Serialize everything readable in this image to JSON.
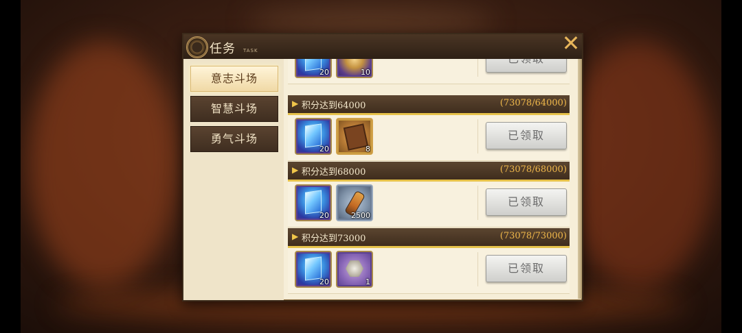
{
  "panel": {
    "title": "任务",
    "title_sub": "TASK",
    "close_symbol": "✕"
  },
  "sidebar": {
    "tabs": [
      {
        "label": "意志斗场",
        "active": true
      },
      {
        "label": "智慧斗场",
        "active": false
      },
      {
        "label": "勇气斗场",
        "active": false
      }
    ]
  },
  "tasks": [
    {
      "title": "",
      "progress": "",
      "rewards": [
        {
          "icon": "crystal-icon",
          "qty": "20"
        },
        {
          "icon": "compass-icon",
          "qty": "10"
        }
      ],
      "button": "已领取"
    },
    {
      "title": "积分达到64000",
      "progress": "(73078/64000)",
      "rewards": [
        {
          "icon": "crystal-icon",
          "qty": "20"
        },
        {
          "icon": "book-icon",
          "qty": "8"
        }
      ],
      "button": "已领取"
    },
    {
      "title": "积分达到68000",
      "progress": "(73078/68000)",
      "rewards": [
        {
          "icon": "crystal-icon",
          "qty": "20"
        },
        {
          "icon": "potion-icon",
          "qty": "2500"
        }
      ],
      "button": "已领取"
    },
    {
      "title": "积分达到73000",
      "progress": "(73078/73000)",
      "rewards": [
        {
          "icon": "crystal-icon",
          "qty": "20"
        },
        {
          "icon": "stone-icon",
          "qty": "1"
        }
      ],
      "button": "已领取"
    }
  ],
  "colors": {
    "accent": "#e6c24a",
    "header_bg": "#4a3524",
    "panel_bg": "#f3ead3",
    "button_disabled": "#cfcfcc"
  }
}
